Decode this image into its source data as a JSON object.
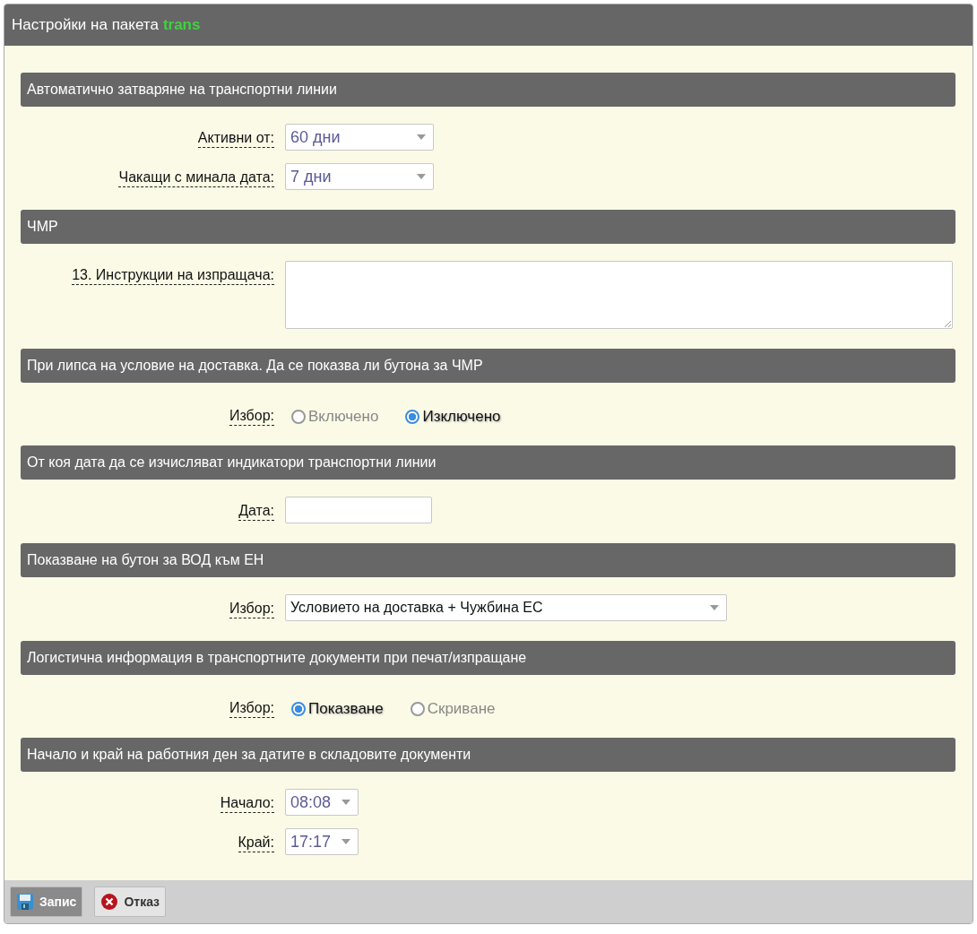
{
  "window": {
    "title": "Настройки на пакета",
    "package": "trans"
  },
  "sections": [
    {
      "title": "Автоматично затваряне на транспортни линии",
      "rows": [
        {
          "label": "Активни от:",
          "kind": "select",
          "value": "60 дни"
        },
        {
          "label": "Чакащи с минала дата:",
          "kind": "select",
          "value": "7 дни"
        }
      ]
    },
    {
      "title": "ЧМР",
      "rows": [
        {
          "label": "13. Инструкции на изпращача:",
          "kind": "textarea"
        }
      ]
    },
    {
      "title": "При липса на условие на доставка. Да се показва ли бутона за ЧМР",
      "rows": [
        {
          "label": "Избор:",
          "kind": "radio",
          "options": [
            {
              "label": "Включено",
              "selected": false
            },
            {
              "label": "Изключено",
              "selected": true
            }
          ]
        }
      ]
    },
    {
      "title": "От коя дата да се изчисляват индикатори транспортни линии",
      "rows": [
        {
          "label": "Дата:",
          "kind": "input"
        }
      ]
    },
    {
      "title": "Показване на бутон за ВОД към ЕН",
      "rows": [
        {
          "label": "Избор:",
          "kind": "wide-select",
          "value": "Условието на доставка + Чужбина ЕС"
        }
      ]
    },
    {
      "title": "Логистична информация в транспортните документи при печат/изпращане",
      "rows": [
        {
          "label": "Избор:",
          "kind": "radio",
          "options": [
            {
              "label": "Показване",
              "selected": true
            },
            {
              "label": "Скриване",
              "selected": false
            }
          ]
        }
      ]
    },
    {
      "title": "Начало и край на работния ден за датите в складовите документи",
      "rows": [
        {
          "label": "Начало:",
          "kind": "time-select",
          "value": "08:08"
        },
        {
          "label": "Край:",
          "kind": "time-select",
          "value": "17:17"
        }
      ]
    }
  ],
  "buttons": [
    {
      "label": "Запис",
      "kind": "save"
    },
    {
      "label": "Отказ",
      "kind": "cancel"
    }
  ]
}
